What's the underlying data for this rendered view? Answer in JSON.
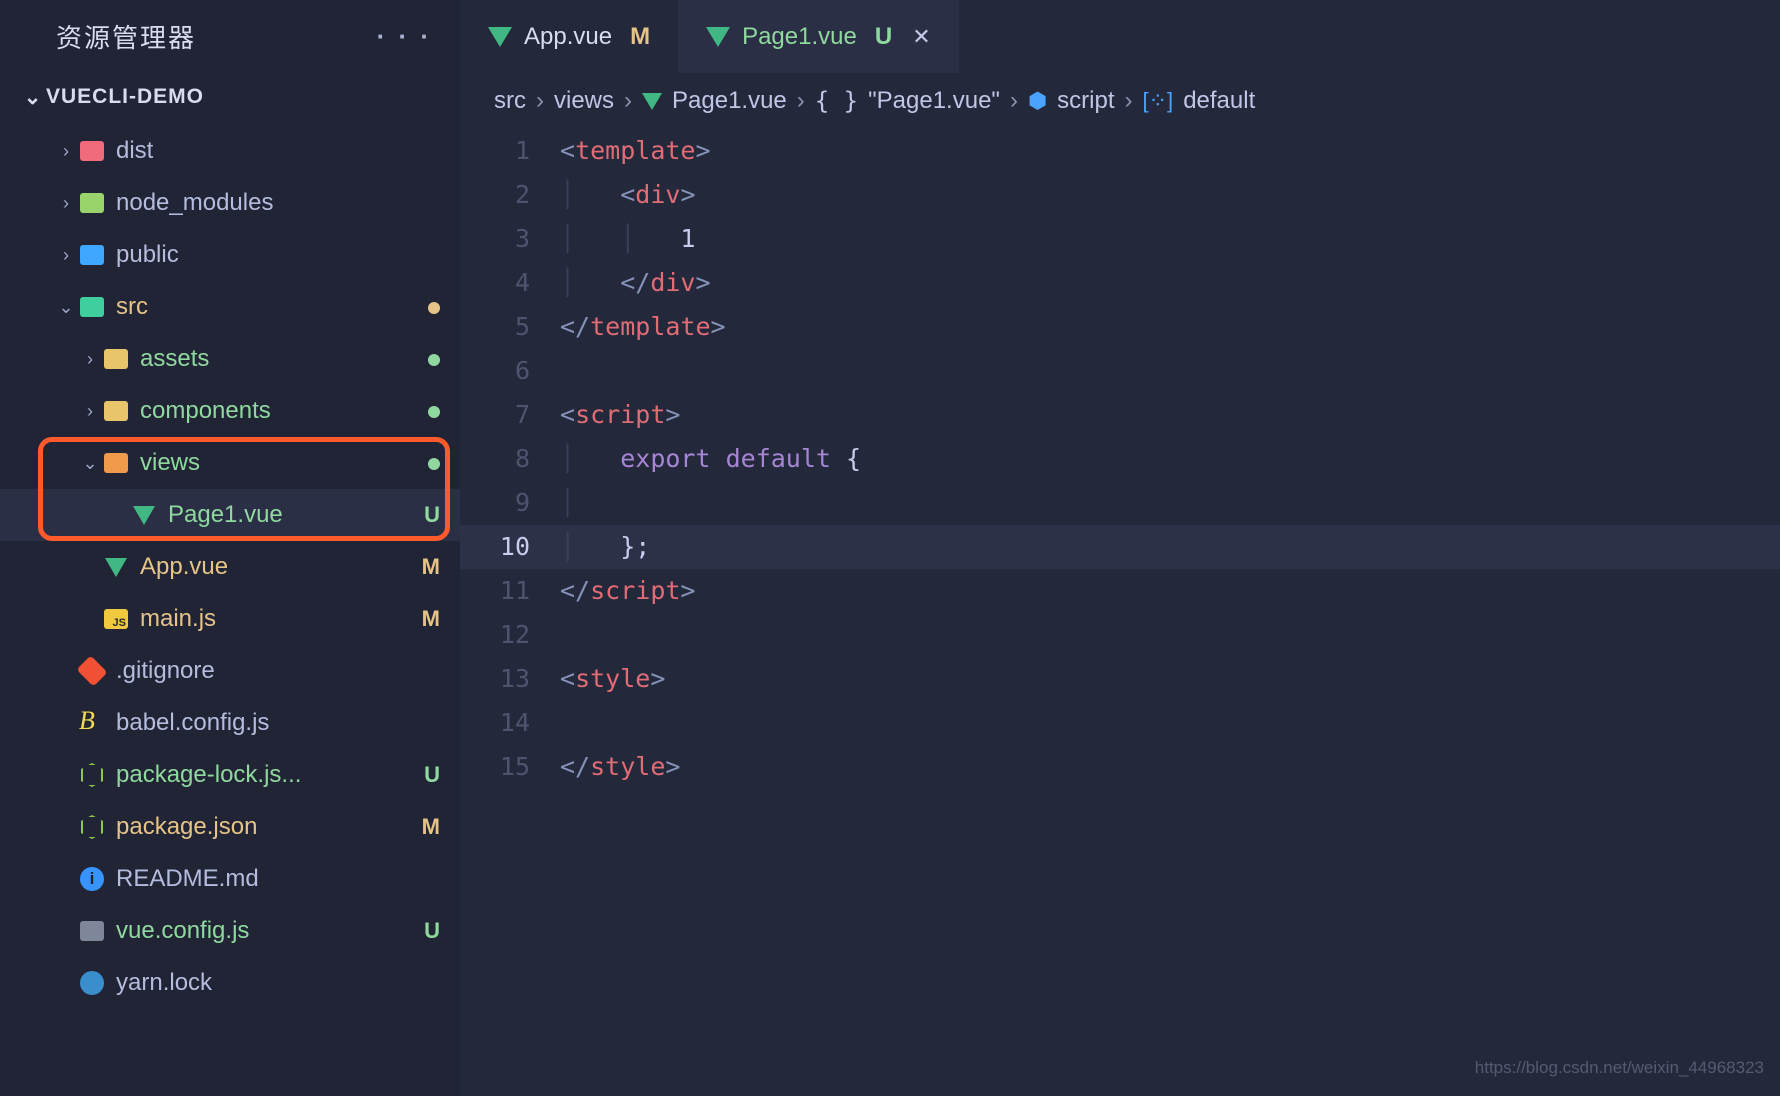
{
  "sidebar": {
    "title": "资源管理器",
    "more": "· · ·",
    "project": "VUECLI-DEMO",
    "tree": {
      "dist": "dist",
      "node_modules": "node_modules",
      "public": "public",
      "src": "src",
      "assets": "assets",
      "components": "components",
      "views": "views",
      "page1": "Page1.vue",
      "app": "App.vue",
      "mainjs": "main.js",
      "gitignore": ".gitignore",
      "babel": "babel.config.js",
      "pkglock": "package-lock.js...",
      "pkg": "package.json",
      "readme": "README.md",
      "vuecfg": "vue.config.js",
      "yarn": "yarn.lock"
    },
    "status": {
      "M": "M",
      "U": "U"
    }
  },
  "tabs": {
    "t0": {
      "title": "App.vue",
      "badge": "M"
    },
    "t1": {
      "title": "Page1.vue",
      "badge": "U"
    }
  },
  "breadcrumb": {
    "p0": "src",
    "p1": "views",
    "p2": "Page1.vue",
    "p3": "\"Page1.vue\"",
    "p4": "script",
    "p5": "default"
  },
  "code": {
    "lines": [
      "1",
      "2",
      "3",
      "4",
      "5",
      "6",
      "7",
      "8",
      "9",
      "10",
      "11",
      "12",
      "13",
      "14",
      "15"
    ],
    "l1": {
      "a": "<",
      "b": "template",
      "c": ">"
    },
    "l2": {
      "a": "<",
      "b": "div",
      "c": ">"
    },
    "l3": {
      "a": "1"
    },
    "l4": {
      "a": "</",
      "b": "div",
      "c": ">"
    },
    "l5": {
      "a": "</",
      "b": "template",
      "c": ">"
    },
    "l7": {
      "a": "<",
      "b": "script",
      "c": ">"
    },
    "l8": {
      "a": "export",
      "b": " ",
      "c": "default",
      "d": " {"
    },
    "l10": {
      "a": "};"
    },
    "l11": {
      "a": "</",
      "b": "script",
      "c": ">"
    },
    "l13": {
      "a": "<",
      "b": "style",
      "c": ">"
    },
    "l15": {
      "a": "</",
      "b": "style",
      "c": ">"
    }
  },
  "watermark": "https://blog.csdn.net/weixin_44968323"
}
